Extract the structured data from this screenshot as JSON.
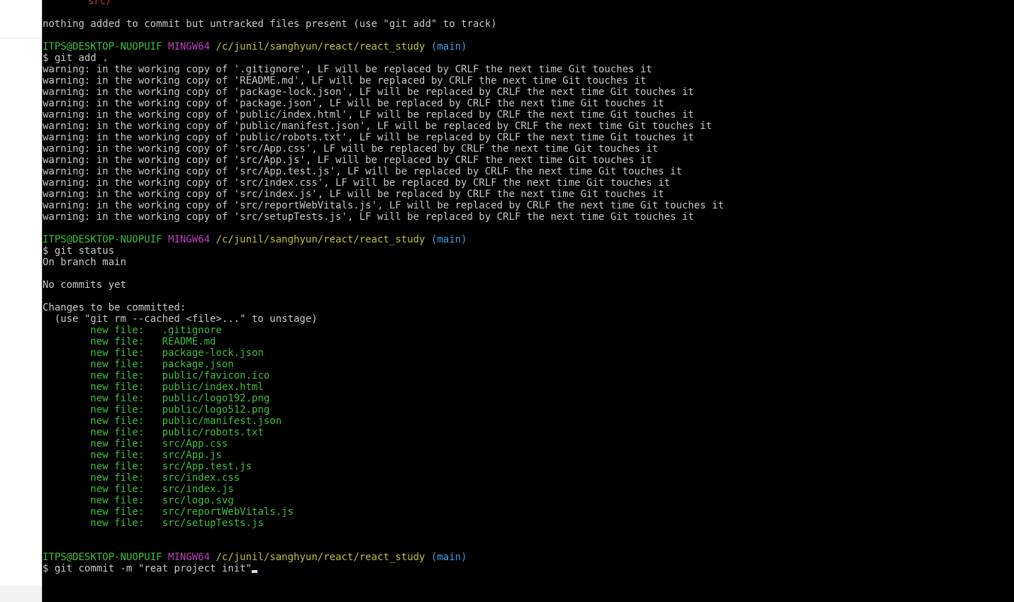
{
  "prompt": {
    "user": "ITPS@DESKTOP-NUOPUIF",
    "env": "MINGW64",
    "path": "/c/junil/sanghyun/react/react_study",
    "branch": "(main)"
  },
  "lines": {
    "top_dir": "src/",
    "nothing_added": "nothing added to commit but untracked files present (use \"git add\" to track)",
    "cmd_add": "$ git add .",
    "cmd_status": "$ git status",
    "on_branch": "On branch main",
    "no_commits": "No commits yet",
    "changes_header": "Changes to be committed:",
    "unstage_hint": "  (use \"git rm --cached <file>...\" to unstage)",
    "cmd_commit": "$ git commit -m \"reat project init\""
  },
  "warnings": [
    "warning: in the working copy of '.gitignore', LF will be replaced by CRLF the next time Git touches it",
    "warning: in the working copy of 'README.md', LF will be replaced by CRLF the next time Git touches it",
    "warning: in the working copy of 'package-lock.json', LF will be replaced by CRLF the next time Git touches it",
    "warning: in the working copy of 'package.json', LF will be replaced by CRLF the next time Git touches it",
    "warning: in the working copy of 'public/index.html', LF will be replaced by CRLF the next time Git touches it",
    "warning: in the working copy of 'public/manifest.json', LF will be replaced by CRLF the next time Git touches it",
    "warning: in the working copy of 'public/robots.txt', LF will be replaced by CRLF the next time Git touches it",
    "warning: in the working copy of 'src/App.css', LF will be replaced by CRLF the next time Git touches it",
    "warning: in the working copy of 'src/App.js', LF will be replaced by CRLF the next time Git touches it",
    "warning: in the working copy of 'src/App.test.js', LF will be replaced by CRLF the next time Git touches it",
    "warning: in the working copy of 'src/index.css', LF will be replaced by CRLF the next time Git touches it",
    "warning: in the working copy of 'src/index.js', LF will be replaced by CRLF the next time Git touches it",
    "warning: in the working copy of 'src/reportWebVitals.js', LF will be replaced by CRLF the next time Git touches it",
    "warning: in the working copy of 'src/setupTests.js', LF will be replaced by CRLF the next time Git touches it"
  ],
  "new_file_label": "        new file:   ",
  "staged_files": [
    ".gitignore",
    "README.md",
    "package-lock.json",
    "package.json",
    "public/favicon.ico",
    "public/index.html",
    "public/logo192.png",
    "public/logo512.png",
    "public/manifest.json",
    "public/robots.txt",
    "src/App.css",
    "src/App.js",
    "src/App.test.js",
    "src/index.css",
    "src/index.js",
    "src/logo.svg",
    "src/reportWebVitals.js",
    "src/setupTests.js"
  ],
  "colors": {
    "background": "#000000",
    "text": "#c8c8c8",
    "user_green": "#3fbf3f",
    "env_pink": "#bf3fbf",
    "path_yellow": "#bfbf3f",
    "branch_cyan": "#3f9fdf",
    "untracked_red": "#d03030"
  }
}
